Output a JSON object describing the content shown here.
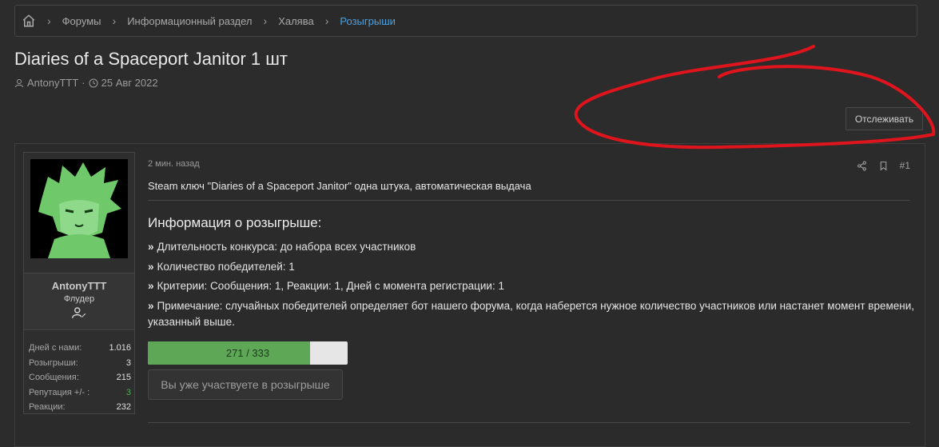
{
  "breadcrumb": {
    "items": [
      "Форумы",
      "Информационный раздел",
      "Халява",
      "Розыгрыши"
    ],
    "icons": {
      "home": "home-icon",
      "separator": "chevron-right-icon"
    }
  },
  "thread": {
    "title": "Diaries of a Spaceport Janitor 1 шт",
    "author": "AntonyTTT",
    "date": "25 Авг 2022",
    "meta_separator": "·"
  },
  "watch_button": "Отслеживать",
  "post": {
    "time": "2 мин. назад",
    "number": "#1",
    "icons": [
      "share-icon",
      "bookmark-icon"
    ],
    "lead": "Steam ключ \"Diaries of a Spaceport Janitor\" одна штука, автоматическая выдача",
    "info_title": "Информация о розыгрыше:",
    "info_items": [
      "Длительность конкурса: до набора всех участников",
      "Количество победителей: 1",
      "Критерии: Сообщения: 1, Реакции: 1, Дней с момента регистрации: 1",
      "Примечание: случайных победителей определяет бот нашего форума, когда наберется нужное количество участников или настанет момент времени, указанный выше."
    ],
    "progress": {
      "current": 271,
      "total": 333,
      "text": "271 / 333"
    },
    "participate_button": "Вы уже участвуете в розыгрыше"
  },
  "user": {
    "name": "AntonyTTT",
    "title": "Флудер",
    "stats": [
      {
        "label": "Дней с нами:",
        "value": "1.016"
      },
      {
        "label": "Розыгрыши:",
        "value": "3"
      },
      {
        "label": "Сообщения:",
        "value": "215"
      },
      {
        "label": "Репутация +/- :",
        "value": "3",
        "color": "#4caf50"
      },
      {
        "label": "Реакции:",
        "value": "232"
      }
    ]
  },
  "colors": {
    "background": "#2c2c2c",
    "link_active": "#4aa0e0",
    "progress_fill": "#5da756",
    "annotation": "#e0141c"
  }
}
